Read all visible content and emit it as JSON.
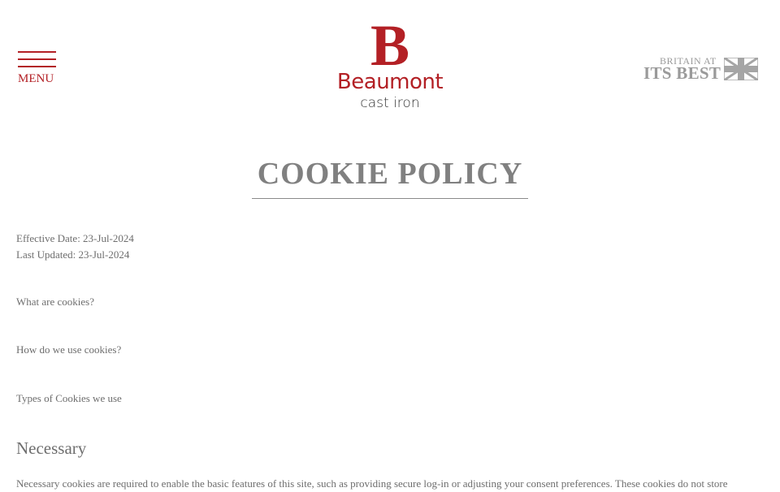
{
  "header": {
    "menu_label": "MENU",
    "logo": {
      "letter": "B",
      "name": "Beaumont",
      "subtitle": "cast iron"
    },
    "badge": {
      "line1": "BRITAIN AT",
      "line2": "ITS BEST"
    }
  },
  "colors": {
    "brand_red": "#b32025",
    "text_grey": "#6e6e6e",
    "title_grey": "#808080"
  },
  "page": {
    "title": "COOKIE POLICY",
    "effective_date": "Effective Date: 23-Jul-2024",
    "last_updated": "Last Updated: 23-Jul-2024",
    "questions": [
      "What are cookies?",
      "How do we use cookies?",
      "Types of Cookies we use"
    ],
    "section": {
      "heading": "Necessary",
      "text": "Necessary cookies are required to enable the basic features of this site, such as providing secure log-in or adjusting your consent preferences. These cookies do not store"
    }
  }
}
